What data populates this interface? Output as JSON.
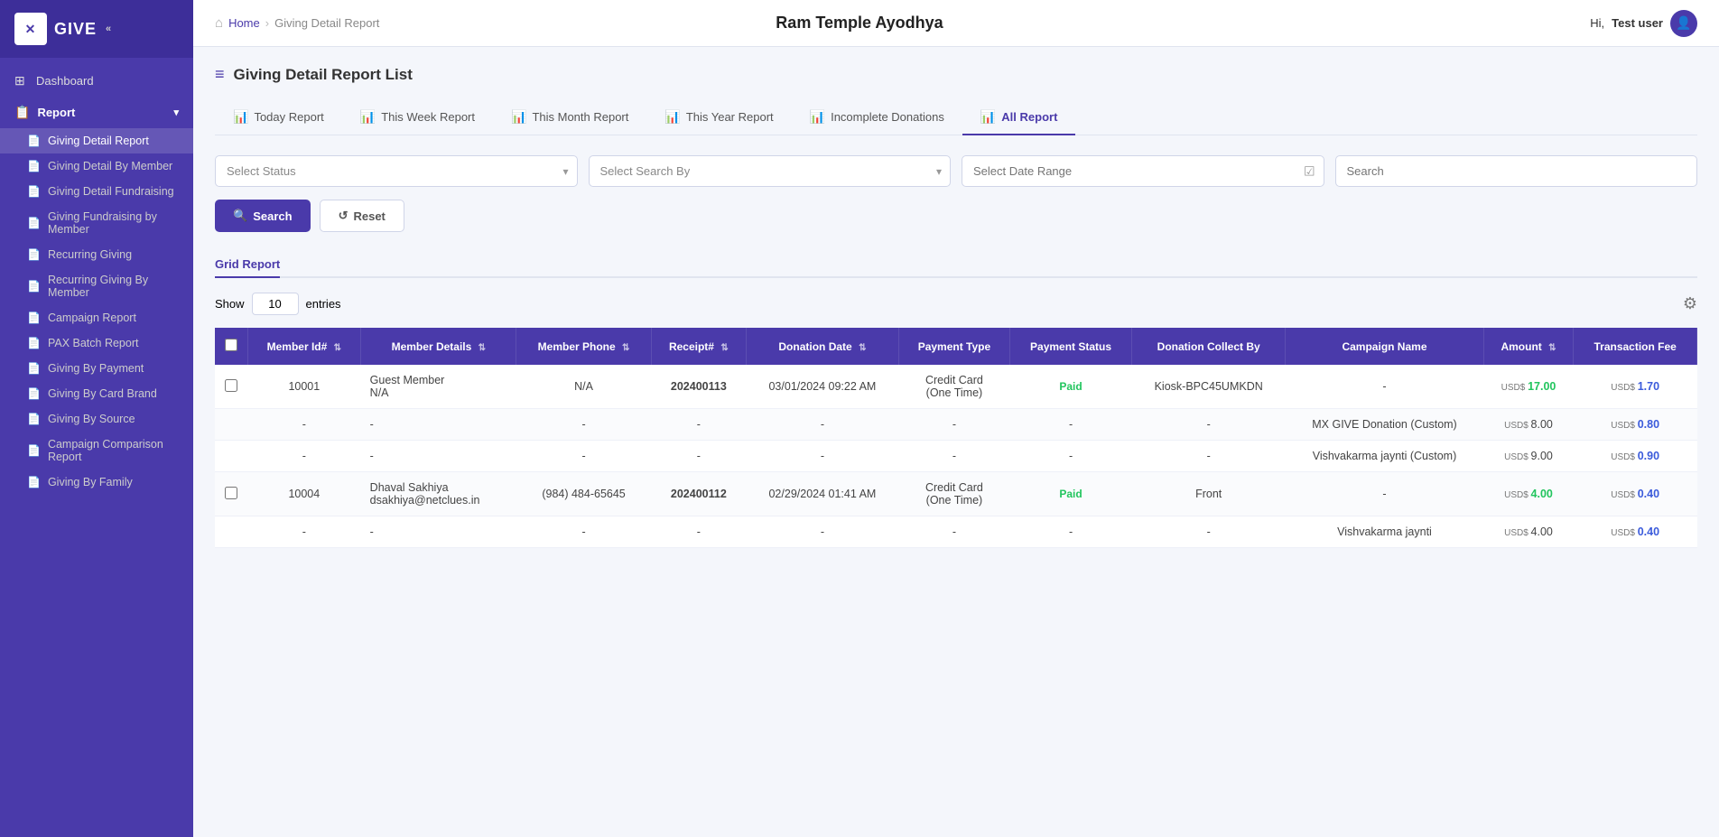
{
  "app": {
    "logo_text": "GIVE",
    "title": "Ram Temple Ayodhya",
    "hi_text": "Hi,",
    "user_name": "Test user"
  },
  "breadcrumb": {
    "home": "Home",
    "current": "Giving Detail Report"
  },
  "sidebar": {
    "nav_items": [
      {
        "id": "dashboard",
        "label": "Dashboard",
        "icon": "⊞",
        "type": "main",
        "active": false
      },
      {
        "id": "report",
        "label": "Report",
        "icon": "📋",
        "type": "main",
        "active": false
      }
    ],
    "sub_items": [
      {
        "id": "giving-detail-report",
        "label": "Giving Detail Report",
        "active": true
      },
      {
        "id": "giving-detail-by-member",
        "label": "Giving Detail By Member",
        "active": false
      },
      {
        "id": "giving-detail-fundraising",
        "label": "Giving Detail Fundraising",
        "active": false
      },
      {
        "id": "giving-fundraising-by-member",
        "label": "Giving Fundraising by Member",
        "active": false
      },
      {
        "id": "recurring-giving",
        "label": "Recurring Giving",
        "active": false
      },
      {
        "id": "recurring-giving-by-member",
        "label": "Recurring Giving By Member",
        "active": false
      },
      {
        "id": "campaign-report",
        "label": "Campaign Report",
        "active": false
      },
      {
        "id": "pax-batch-report",
        "label": "PAX Batch Report",
        "active": false
      },
      {
        "id": "giving-by-payment",
        "label": "Giving By Payment",
        "active": false
      },
      {
        "id": "giving-by-card-brand",
        "label": "Giving By Card Brand",
        "active": false
      },
      {
        "id": "giving-by-source",
        "label": "Giving By Source",
        "active": false
      },
      {
        "id": "campaign-comparison-report",
        "label": "Campaign Comparison Report",
        "active": false
      },
      {
        "id": "giving-by-family",
        "label": "Giving By Family",
        "active": false
      }
    ]
  },
  "page": {
    "title": "Giving Detail Report List",
    "icon": "≡"
  },
  "tabs": [
    {
      "id": "today",
      "label": "Today Report",
      "icon": "📊",
      "active": false
    },
    {
      "id": "week",
      "label": "This Week Report",
      "icon": "📊",
      "active": false
    },
    {
      "id": "month",
      "label": "This Month Report",
      "icon": "📊",
      "active": false
    },
    {
      "id": "year",
      "label": "This Year Report",
      "icon": "📊",
      "active": false
    },
    {
      "id": "incomplete",
      "label": "Incomplete Donations",
      "icon": "📊",
      "active": false
    },
    {
      "id": "all",
      "label": "All Report",
      "icon": "📊",
      "active": true
    }
  ],
  "filters": {
    "status_placeholder": "Select Status",
    "search_by_placeholder": "Select Search By",
    "date_range_placeholder": "Select Date Range",
    "search_placeholder": "Search"
  },
  "buttons": {
    "search": "Search",
    "reset": "Reset"
  },
  "grid": {
    "tab_label": "Grid Report",
    "show_label": "Show",
    "entries_label": "entries",
    "entries_value": "10"
  },
  "table": {
    "columns": [
      {
        "id": "checkbox",
        "label": ""
      },
      {
        "id": "member_id",
        "label": "Member Id#",
        "sortable": true
      },
      {
        "id": "member_details",
        "label": "Member Details",
        "sortable": true
      },
      {
        "id": "member_phone",
        "label": "Member Phone",
        "sortable": true
      },
      {
        "id": "receipt",
        "label": "Receipt#",
        "sortable": true
      },
      {
        "id": "donation_date",
        "label": "Donation Date",
        "sortable": true
      },
      {
        "id": "payment_type",
        "label": "Payment Type",
        "sortable": false
      },
      {
        "id": "payment_status",
        "label": "Payment Status",
        "sortable": false
      },
      {
        "id": "donation_collect_by",
        "label": "Donation Collect By",
        "sortable": false
      },
      {
        "id": "campaign_name",
        "label": "Campaign Name",
        "sortable": false
      },
      {
        "id": "amount",
        "label": "Amount",
        "sortable": true
      },
      {
        "id": "transaction_fee",
        "label": "Transaction Fee",
        "sortable": false
      }
    ],
    "rows": [
      {
        "checkbox": true,
        "member_id": "10001",
        "member_details": "Guest Member\nN/A",
        "member_phone": "N/A",
        "receipt": "202400113",
        "receipt_bold": true,
        "donation_date": "03/01/2024 09:22 AM",
        "payment_type": "Credit Card\n(One Time)",
        "payment_status": "Paid",
        "payment_status_type": "paid",
        "donation_collect_by": "Kiosk-BPC45UMKDN",
        "campaign_name": "-",
        "amount": "USD$ 17.00",
        "amount_color": "green",
        "transaction_fee": "USD$ 1.70",
        "transaction_color": "blue"
      },
      {
        "checkbox": false,
        "member_id": "-",
        "member_details": "-",
        "member_phone": "-",
        "receipt": "-",
        "receipt_bold": false,
        "donation_date": "-",
        "payment_type": "-",
        "payment_status": "-",
        "payment_status_type": "none",
        "donation_collect_by": "-",
        "campaign_name": "MX GIVE Donation (Custom)",
        "amount": "USD$ 8.00",
        "amount_color": "normal",
        "transaction_fee": "USD$ 0.80",
        "transaction_color": "blue"
      },
      {
        "checkbox": false,
        "member_id": "-",
        "member_details": "-",
        "member_phone": "-",
        "receipt": "-",
        "receipt_bold": false,
        "donation_date": "-",
        "payment_type": "-",
        "payment_status": "-",
        "payment_status_type": "none",
        "donation_collect_by": "-",
        "campaign_name": "Vishvakarma jaynti (Custom)",
        "amount": "USD$ 9.00",
        "amount_color": "normal",
        "transaction_fee": "USD$ 0.90",
        "transaction_color": "blue"
      },
      {
        "checkbox": true,
        "member_id": "10004",
        "member_details": "Dhaval Sakhiya\ndsakhiya@netclues.in",
        "member_phone": "(984) 484-65645",
        "receipt": "202400112",
        "receipt_bold": true,
        "donation_date": "02/29/2024 01:41 AM",
        "payment_type": "Credit Card\n(One Time)",
        "payment_status": "Paid",
        "payment_status_type": "paid",
        "donation_collect_by": "Front",
        "campaign_name": "-",
        "amount": "USD$ 4.00",
        "amount_color": "green",
        "transaction_fee": "USD$ 0.40",
        "transaction_color": "blue"
      },
      {
        "checkbox": false,
        "member_id": "-",
        "member_details": "-",
        "member_phone": "-",
        "receipt": "-",
        "receipt_bold": false,
        "donation_date": "-",
        "payment_type": "-",
        "payment_status": "-",
        "payment_status_type": "none",
        "donation_collect_by": "-",
        "campaign_name": "Vishvakarma jaynti",
        "amount": "USD$ 4.00",
        "amount_color": "normal",
        "transaction_fee": "USD$ 0.40",
        "transaction_color": "blue"
      }
    ]
  }
}
